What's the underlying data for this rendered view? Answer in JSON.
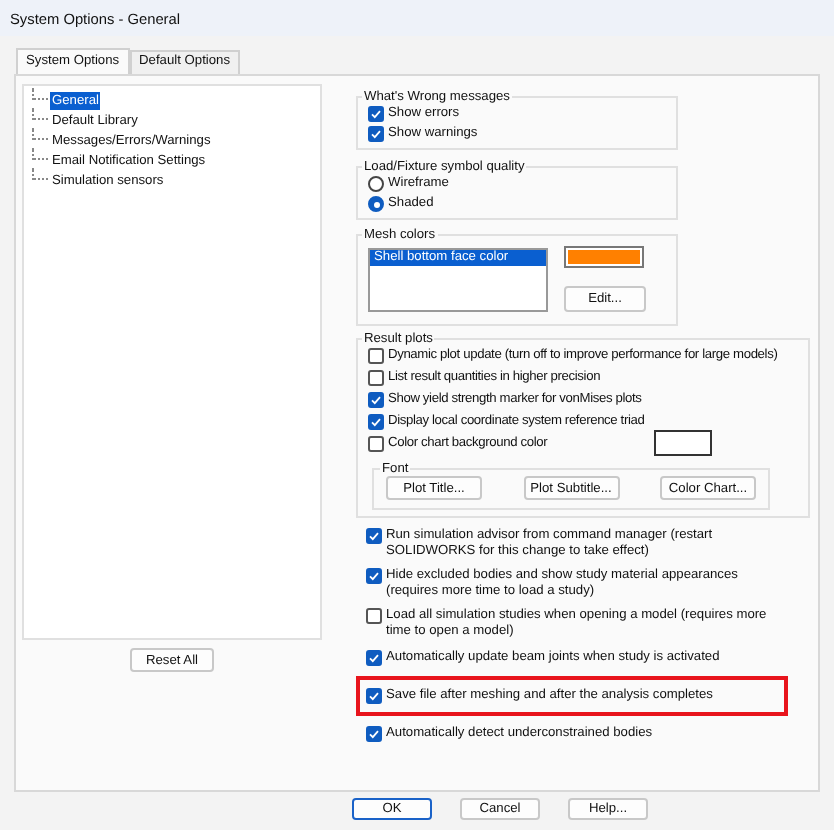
{
  "window": {
    "title": "System Options - General"
  },
  "tabs": [
    {
      "label": "System Options",
      "selected": true
    },
    {
      "label": "Default Options",
      "selected": false
    }
  ],
  "tree": {
    "items": [
      {
        "label": "General",
        "selected": true
      },
      {
        "label": "Default Library",
        "selected": false
      },
      {
        "label": "Messages/Errors/Warnings",
        "selected": false
      },
      {
        "label": "Email Notification Settings",
        "selected": false
      },
      {
        "label": "Simulation sensors",
        "selected": false
      }
    ]
  },
  "reset_button": "Reset All",
  "whats_wrong": {
    "title": "What's Wrong messages",
    "options": [
      {
        "label": "Show errors",
        "checked": true
      },
      {
        "label": "Show warnings",
        "checked": true
      }
    ]
  },
  "symbol_quality": {
    "title": "Load/Fixture symbol quality",
    "options": [
      {
        "label": "Wireframe",
        "selected": false
      },
      {
        "label": "Shaded",
        "selected": true
      }
    ]
  },
  "mesh_colors": {
    "title": "Mesh colors",
    "items": [
      {
        "label": "Shell bottom face color",
        "selected": true
      }
    ],
    "color": "#ff8000",
    "edit_button": "Edit..."
  },
  "result_plots": {
    "title": "Result plots",
    "options": [
      {
        "label": "Dynamic plot update (turn off to improve performance for large models)",
        "checked": false
      },
      {
        "label": "List result quantities in higher precision",
        "checked": false
      },
      {
        "label": "Show yield strength marker for vonMises plots",
        "checked": true
      },
      {
        "label": "Display local coordinate system reference triad",
        "checked": true
      },
      {
        "label": "Color chart background color",
        "checked": false
      }
    ],
    "color": "#ffffff",
    "font": {
      "title": "Font",
      "buttons": [
        "Plot Title...",
        "Plot Subtitle...",
        "Color Chart..."
      ]
    }
  },
  "options": [
    {
      "label": "Run simulation advisor from command manager (restart SOLIDWORKS for this change to take effect)",
      "checked": true,
      "highlighted": false
    },
    {
      "label": "Hide excluded bodies and show study material appearances (requires more time to load a study)",
      "checked": true,
      "highlighted": false
    },
    {
      "label": "Load all simulation studies when opening a model (requires more time to open a model)",
      "checked": false,
      "highlighted": false
    },
    {
      "label": "Automatically update beam joints when study is activated",
      "checked": true,
      "highlighted": false
    },
    {
      "label": "Save file after meshing and after the analysis completes",
      "checked": true,
      "highlighted": true
    },
    {
      "label": "Automatically detect underconstrained bodies",
      "checked": true,
      "highlighted": false
    }
  ],
  "buttons": [
    "OK",
    "Cancel",
    "Help..."
  ]
}
